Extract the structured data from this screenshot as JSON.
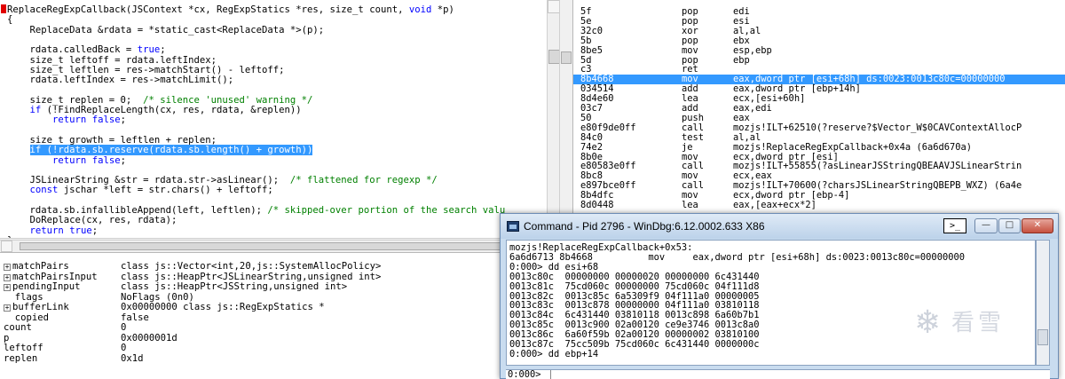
{
  "source": {
    "lines": [
      {
        "text": "ReplaceRegExpCallback(JSContext *cx, RegExpStatics *res, size_t count, void *p)",
        "kind": "plain"
      },
      {
        "text": "{",
        "kind": "plain"
      },
      {
        "text": "    ReplaceData &rdata = *static_cast<ReplaceData *>(p);",
        "kind": "plain"
      },
      {
        "text": "",
        "kind": "plain"
      },
      {
        "text": "    rdata.calledBack = true;",
        "kind": "plain"
      },
      {
        "text": "    size_t leftoff = rdata.leftIndex;",
        "kind": "plain"
      },
      {
        "text": "    size_t leftlen = res->matchStart() - leftoff;",
        "kind": "plain"
      },
      {
        "text": "    rdata.leftIndex = res->matchLimit();",
        "kind": "plain"
      },
      {
        "text": "",
        "kind": "plain"
      },
      {
        "text": "    size_t replen = 0;  /* silence 'unused' warning */",
        "kind": "plain"
      },
      {
        "text": "    if (!FindReplaceLength(cx, res, rdata, &replen))",
        "kind": "plain"
      },
      {
        "text": "        return false;",
        "kind": "plain"
      },
      {
        "text": "",
        "kind": "plain"
      },
      {
        "text": "    size_t growth = leftlen + replen;",
        "kind": "plain"
      },
      {
        "text": "    if (!rdata.sb.reserve(rdata.sb.length() + growth))",
        "kind": "highlight"
      },
      {
        "text": "        return false;",
        "kind": "plain"
      },
      {
        "text": "",
        "kind": "plain"
      },
      {
        "text": "    JSLinearString &str = rdata.str->asLinear();  /* flattened for regexp */",
        "kind": "plain"
      },
      {
        "text": "    const jschar *left = str.chars() + leftoff;",
        "kind": "plain"
      },
      {
        "text": "",
        "kind": "plain"
      },
      {
        "text": "    rdata.sb.infallibleAppend(left, leftlen); /* skipped-over portion of the search valu",
        "kind": "plain"
      },
      {
        "text": "    DoReplace(cx, res, rdata);",
        "kind": "plain"
      },
      {
        "text": "    return true;",
        "kind": "plain"
      },
      {
        "text": "}",
        "kind": "plain"
      }
    ]
  },
  "locals": {
    "rows": [
      {
        "expand": "+",
        "name": "matchPairs",
        "type": "class js::Vector<int,20,js::SystemAllocPolicy>"
      },
      {
        "expand": "+",
        "name": "matchPairsInput",
        "type": "class js::HeapPtr<JSLinearString,unsigned int>"
      },
      {
        "expand": "+",
        "name": "pendingInput",
        "type": "class js::HeapPtr<JSString,unsigned int>"
      },
      {
        "expand": "",
        "name": "  flags",
        "type": "NoFlags (0n0)"
      },
      {
        "expand": "+",
        "name": "bufferLink",
        "type": "0x00000000 class js::RegExpStatics *"
      },
      {
        "expand": "",
        "name": "  copied",
        "type": "false"
      },
      {
        "expand": "",
        "name": "count",
        "type": "0"
      },
      {
        "expand": "",
        "name": "p",
        "type": "0x0000001d"
      },
      {
        "expand": "",
        "name": "leftoff",
        "type": "0"
      },
      {
        "expand": "",
        "name": "replen",
        "type": "0x1d"
      }
    ]
  },
  "disasm": {
    "rows": [
      {
        "bytes": "5f",
        "op": "pop",
        "args": "edi",
        "selected": false
      },
      {
        "bytes": "5e",
        "op": "pop",
        "args": "esi",
        "selected": false
      },
      {
        "bytes": "32c0",
        "op": "xor",
        "args": "al,al",
        "selected": false
      },
      {
        "bytes": "5b",
        "op": "pop",
        "args": "ebx",
        "selected": false
      },
      {
        "bytes": "8be5",
        "op": "mov",
        "args": "esp,ebp",
        "selected": false
      },
      {
        "bytes": "5d",
        "op": "pop",
        "args": "ebp",
        "selected": false
      },
      {
        "bytes": "c3",
        "op": "ret",
        "args": "",
        "selected": false
      },
      {
        "bytes": "8b4668",
        "op": "mov",
        "args": "eax,dword ptr [esi+68h] ds:0023:0013c80c=00000000",
        "selected": true
      },
      {
        "bytes": "034514",
        "op": "add",
        "args": "eax,dword ptr [ebp+14h]",
        "selected": false
      },
      {
        "bytes": "8d4e60",
        "op": "lea",
        "args": "ecx,[esi+60h]",
        "selected": false
      },
      {
        "bytes": "03c7",
        "op": "add",
        "args": "eax,edi",
        "selected": false
      },
      {
        "bytes": "50",
        "op": "push",
        "args": "eax",
        "selected": false
      },
      {
        "bytes": "e80f9de0ff",
        "op": "call",
        "args": "mozjs!ILT+62510(?reserve?$Vector_W$0CAVContextAllocP",
        "selected": false
      },
      {
        "bytes": "84c0",
        "op": "test",
        "args": "al,al",
        "selected": false
      },
      {
        "bytes": "74e2",
        "op": "je",
        "args": "mozjs!ReplaceRegExpCallback+0x4a (6a6d670a)",
        "selected": false
      },
      {
        "bytes": "8b0e",
        "op": "mov",
        "args": "ecx,dword ptr [esi]",
        "selected": false
      },
      {
        "bytes": "e80583e0ff",
        "op": "call",
        "args": "mozjs!ILT+55855(?asLinearJSStringQBEAAVJSLinearStrin",
        "selected": false
      },
      {
        "bytes": "8bc8",
        "op": "mov",
        "args": "ecx,eax",
        "selected": false
      },
      {
        "bytes": "e897bce0ff",
        "op": "call",
        "args": "mozjs!ILT+70600(?charsJSLinearStringQBEPB_WXZ) (6a4e",
        "selected": false
      },
      {
        "bytes": "8b4dfc",
        "op": "mov",
        "args": "ecx,dword ptr [ebp-4]",
        "selected": false
      },
      {
        "bytes": "8d0448",
        "op": "lea",
        "args": "eax,[eax+ecx*2]",
        "selected": false
      }
    ]
  },
  "command_window": {
    "title": "Command - Pid 2796 - WinDbg:6.12.0002.633 X86",
    "prompt_icon": ">_",
    "minimize_glyph": "—",
    "maximize_glyph": "□",
    "close_glyph": "✕",
    "output": [
      "mozjs!ReplaceRegExpCallback+0x53:",
      "6a6d6713 8b4668          mov     eax,dword ptr [esi+68h] ds:0023:0013c80c=00000000",
      "0:000> dd esi+68",
      "0013c80c  00000000 00000020 00000000 6c431440",
      "0013c81c  75cd060c 00000000 75cd060c 04f111d8",
      "0013c82c  0013c85c 6a5309f9 04f111a0 00000005",
      "0013c83c  0013c878 00000000 04f111a0 03810118",
      "0013c84c  6c431440 03810118 0013c898 6a60b7b1",
      "0013c85c  0013c900 02a00120 ce9e3746 0013c8a0",
      "0013c86c  6a60f59b 02a00120 00000002 03810100",
      "0013c87c  75cc509b 75cd060c 6c431440 0000000c",
      "0:000> dd ebp+14"
    ],
    "input_prompt": "0:000>",
    "input_value": ""
  },
  "watermark": {
    "text": "看雪",
    "glyph": "❄"
  },
  "colors": {
    "selection": "#3399ff",
    "keyword": "#0000ff",
    "comment": "#008000",
    "window_frame": "#c9dcef"
  }
}
